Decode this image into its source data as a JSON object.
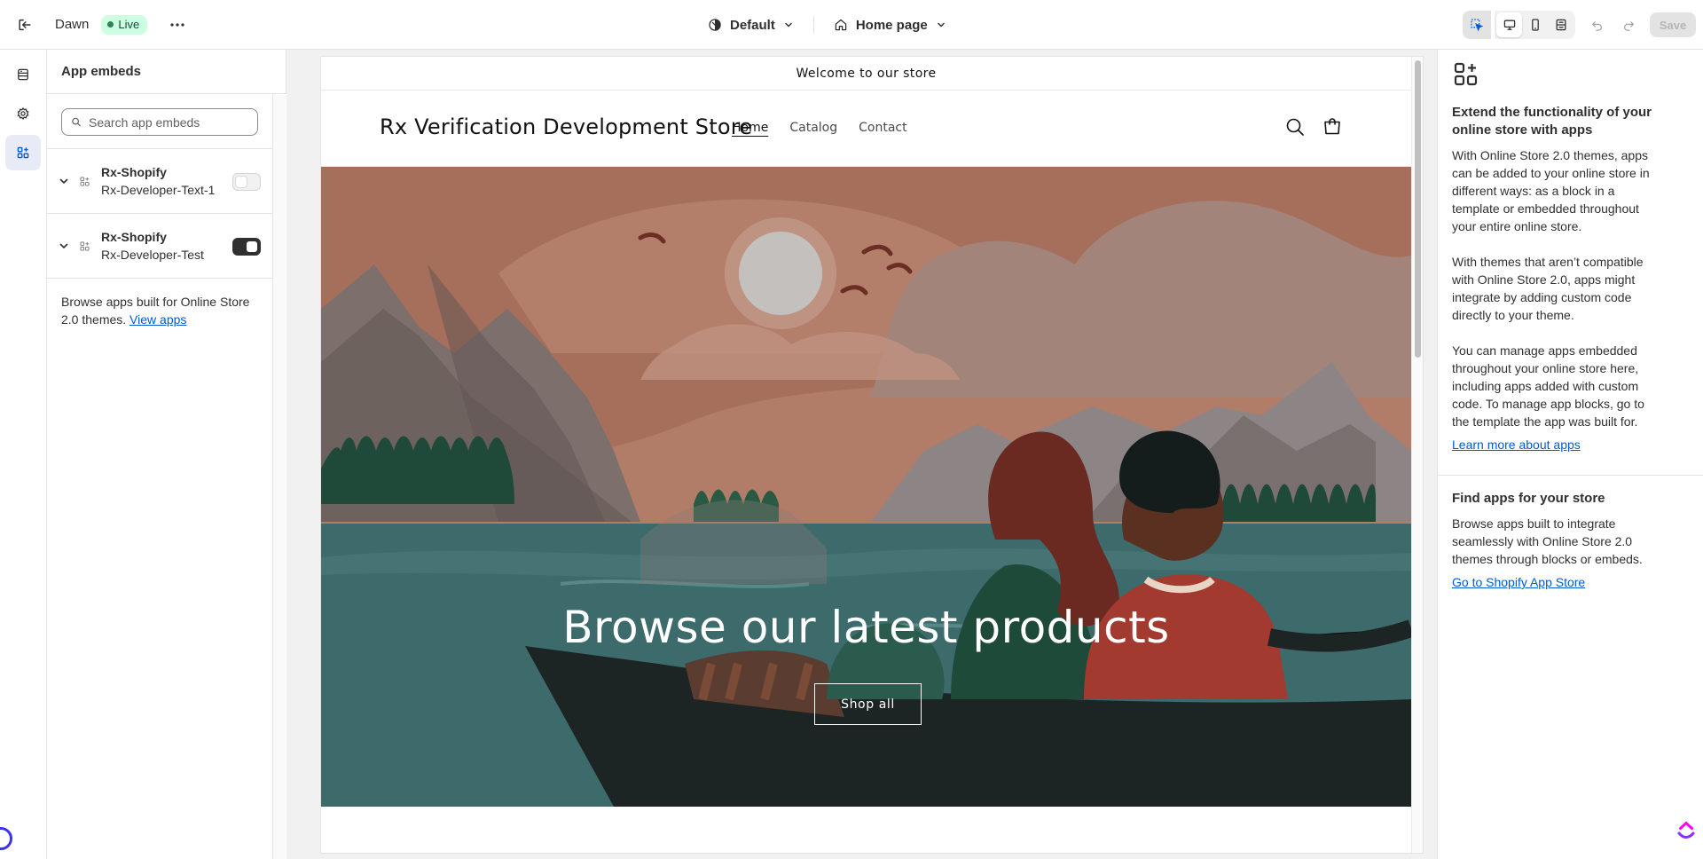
{
  "topbar": {
    "theme_name": "Dawn",
    "live_label": "Live",
    "theme_select": "Default",
    "page_select": "Home page",
    "save_label": "Save"
  },
  "sidebar": {
    "title": "App embeds",
    "search_placeholder": "Search app embeds",
    "embeds": [
      {
        "app": "Rx-Shopify",
        "name": "Rx-Developer-Text-1",
        "enabled": false
      },
      {
        "app": "Rx-Shopify",
        "name": "Rx-Developer-Test",
        "enabled": true
      }
    ],
    "browse_text": "Browse apps built for Online Store 2.0 themes.",
    "browse_link": "View apps"
  },
  "preview": {
    "announcement": "Welcome to our store",
    "store_name": "Rx Verification Development Store",
    "nav": [
      "Home",
      "Catalog",
      "Contact"
    ],
    "hero_title": "Browse our latest products",
    "hero_button": "Shop all"
  },
  "right_panel": {
    "heading": "Extend the functionality of your online store with apps",
    "para1": "With Online Store 2.0 themes, apps can be added to your online store in different ways: as a block in a template or embedded throughout your entire online store.",
    "para2": "With themes that aren’t compatible with Online Store 2.0, apps might integrate by adding custom code directly to your theme.",
    "para3": "You can manage apps embedded throughout your online store here, including apps added with custom code. To manage app blocks, go to the template the app was built for.",
    "link1": "Learn more about apps",
    "heading2": "Find apps for your store",
    "para4": "Browse apps built to integrate seamlessly with Online Store 2.0 themes through blocks or embeds.",
    "link2": "Go to Shopify App Store"
  },
  "colors": {
    "accent_link": "#005bd3",
    "live_badge_bg": "#cdfee1",
    "hero_sky": "#b17d68",
    "hero_water": "#3d6a6a"
  },
  "icons": [
    "exit-icon",
    "more-icon",
    "theme-icon",
    "chevron-down-icon",
    "home-icon",
    "inspect-icon",
    "desktop-icon",
    "mobile-icon",
    "fullwidth-icon",
    "undo-icon",
    "redo-icon",
    "sections-icon",
    "settings-icon",
    "app-embeds-icon",
    "search-icon",
    "cart-icon",
    "apps-icon"
  ]
}
